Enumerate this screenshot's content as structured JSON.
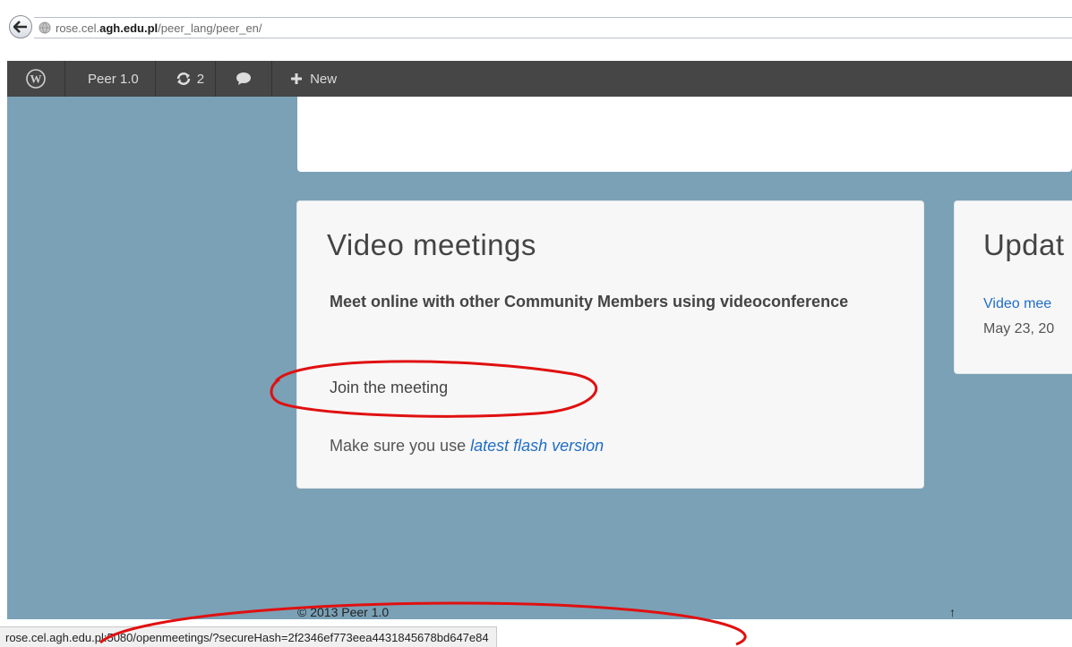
{
  "browser": {
    "url_prefix": "rose.cel.",
    "url_host": "agh.edu.pl",
    "url_path": "/peer_lang/peer_en/"
  },
  "admin_bar": {
    "site_name": "Peer 1.0",
    "updates_count": "2",
    "new_label": "New"
  },
  "main_card": {
    "title": "Video meetings",
    "subtitle": "Meet online with other Community Members using videoconference",
    "join_link": "Join the meeting",
    "flash_prefix": "Make sure you use ",
    "flash_link": "latest flash version"
  },
  "side_card": {
    "title": "Updat",
    "link": "Video mee",
    "date": "May 23, 20"
  },
  "footer": {
    "text": "© 2013 Peer 1.0",
    "arrow": "↑"
  },
  "status_bar": {
    "url": "rose.cel.agh.edu.pl:5080/openmeetings/?secureHash=2f2346ef773eea4431845678bd647e84"
  },
  "colors": {
    "page_background": "#7aa1b6",
    "admin_bar": "#464646",
    "link": "#1f6dc6",
    "annotation": "#e01010"
  }
}
